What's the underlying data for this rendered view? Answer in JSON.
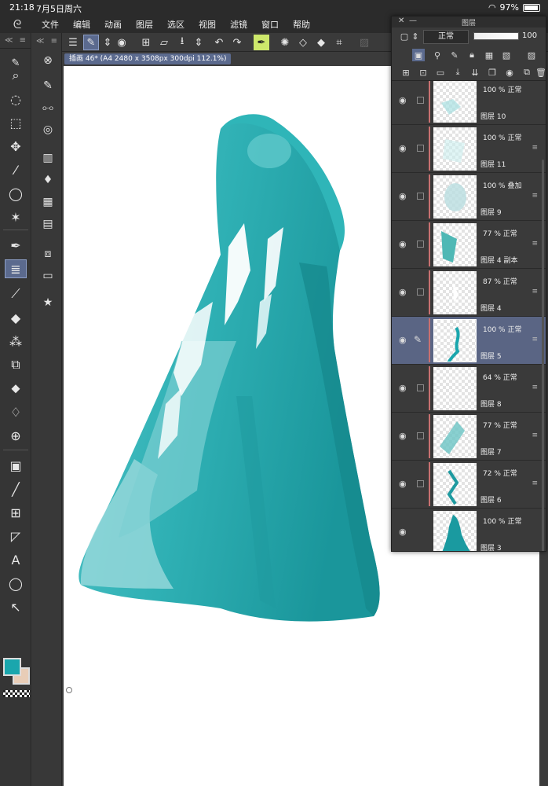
{
  "status": {
    "time": "21:18",
    "date": "7月5日周六",
    "battery": "97%"
  },
  "menu": [
    "文件",
    "编辑",
    "动画",
    "图层",
    "选区",
    "视图",
    "滤镜",
    "窗口",
    "帮助"
  ],
  "document": {
    "tab": "插画 46* (A4 2480 x 3508px 300dpi 112.1%)"
  },
  "colors": {
    "main": "#1aa6ad",
    "sub": "#e8cdb7",
    "selection": "#5b6a8e"
  },
  "layer_panel": {
    "title": "图层",
    "blend_mode": "正常",
    "opacity": "100",
    "layers": [
      {
        "opacity": "100 %  正常",
        "name": "图层 10"
      },
      {
        "opacity": "100 %  正常",
        "name": "图层 11"
      },
      {
        "opacity": "100 %  叠加",
        "name": "图层 9"
      },
      {
        "opacity": "77 %  正常",
        "name": "图层 4 副本"
      },
      {
        "opacity": "87 %  正常",
        "name": "图层 4"
      },
      {
        "opacity": "100 %  正常",
        "name": "图层 5"
      },
      {
        "opacity": "64 %  正常",
        "name": "图层 8"
      },
      {
        "opacity": "77 %  正常",
        "name": "图层 7"
      },
      {
        "opacity": "72 %  正常",
        "name": "图层 6"
      },
      {
        "opacity": "100 %  正常",
        "name": "图层 3"
      }
    ]
  }
}
